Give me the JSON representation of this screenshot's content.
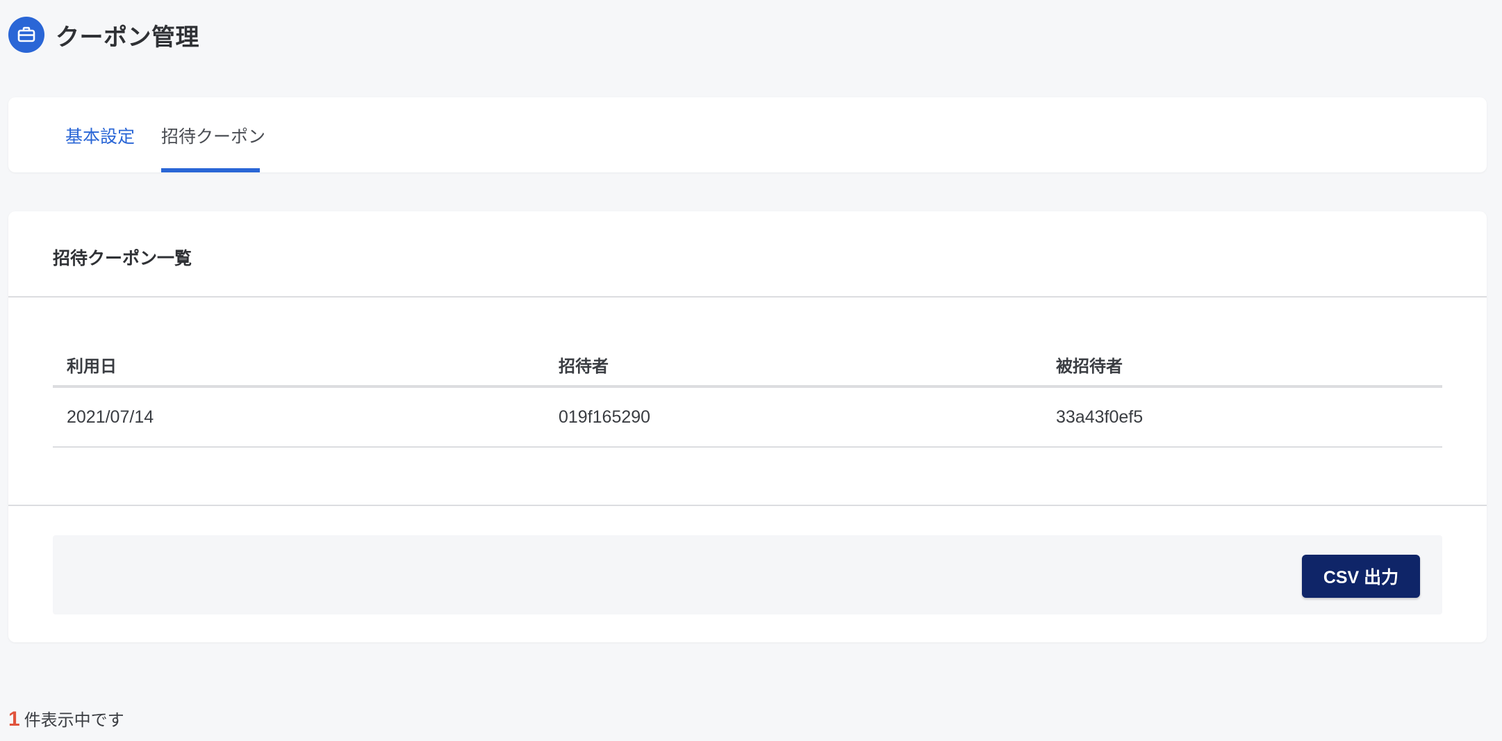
{
  "header": {
    "title": "クーポン管理",
    "icon": "briefcase-icon",
    "icon_color": "#2a66d6"
  },
  "tabs": [
    {
      "label": "基本設定",
      "active": false
    },
    {
      "label": "招待クーポン",
      "active": true
    }
  ],
  "list": {
    "heading": "招待クーポン一覧",
    "columns": [
      "利用日",
      "招待者",
      "被招待者"
    ],
    "rows": [
      [
        "2021/07/14",
        "019f165290",
        "33a43f0ef5"
      ]
    ]
  },
  "actions": {
    "csv_label": "CSV 出力"
  },
  "footer": {
    "count": "1",
    "suffix": "件表示中です"
  },
  "colors": {
    "accent": "#2a66d6",
    "button": "#0f2568",
    "count": "#e0543d"
  }
}
